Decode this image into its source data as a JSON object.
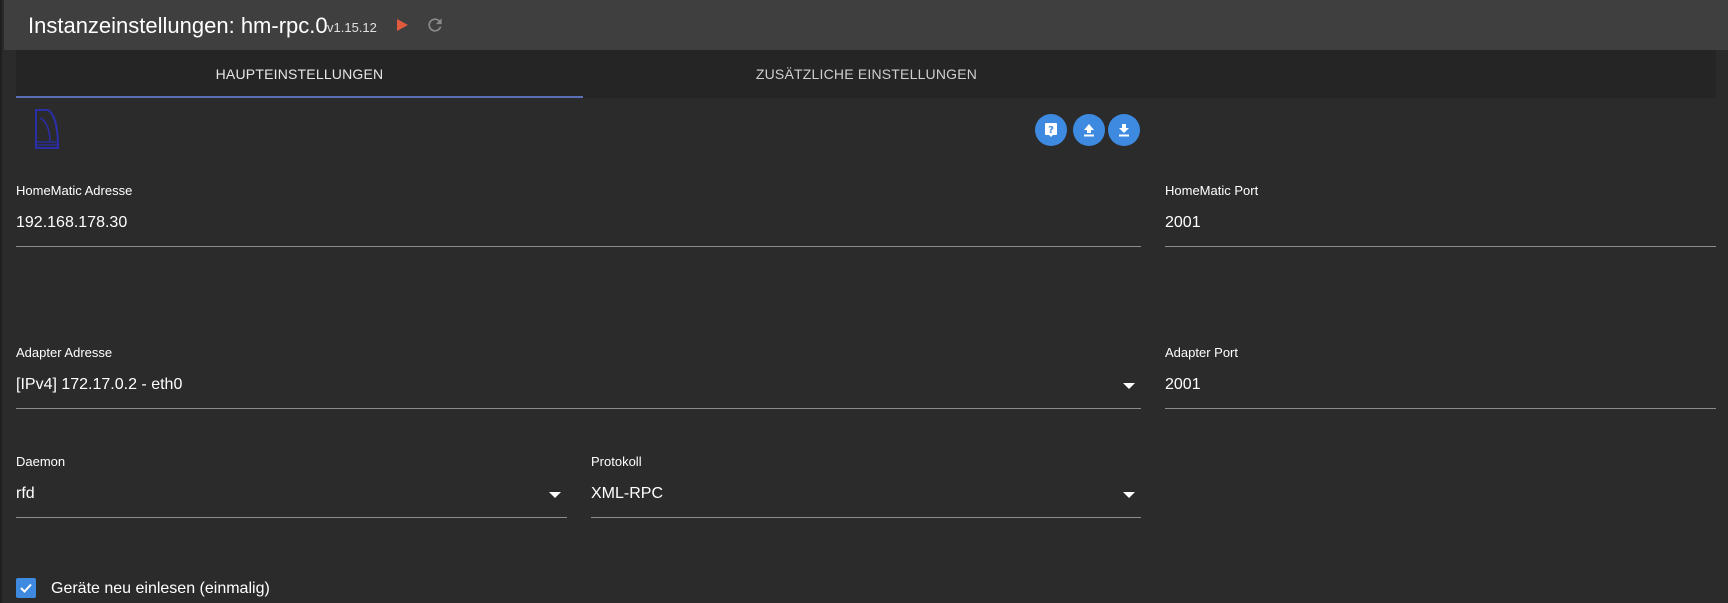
{
  "header": {
    "title": "Instanzeinstellungen: hm-rpc.0",
    "version": "v1.15.12",
    "colors": {
      "play": "#e05a3d",
      "reload": "#8a8a8a"
    }
  },
  "tabs": [
    {
      "label": "HAUPTEINSTELLUNGEN",
      "active": true
    },
    {
      "label": "ZUSÄTZLICHE EINSTELLUNGEN",
      "active": false
    }
  ],
  "actions": {
    "help_icon": "help-icon",
    "upload_icon": "upload-icon",
    "download_icon": "download-icon",
    "accent": "#3d8ae0"
  },
  "fields": {
    "homematic_address": {
      "label": "HomeMatic Adresse",
      "value": "192.168.178.30"
    },
    "homematic_port": {
      "label": "HomeMatic Port",
      "value": "2001"
    },
    "adapter_address": {
      "label": "Adapter Adresse",
      "value": "[IPv4] 172.17.0.2 - eth0"
    },
    "adapter_port": {
      "label": "Adapter Port",
      "value": "2001"
    },
    "daemon": {
      "label": "Daemon",
      "value": "rfd"
    },
    "protocol": {
      "label": "Protokoll",
      "value": "XML-RPC"
    }
  },
  "checkbox": {
    "label": "Geräte neu einlesen (einmalig)",
    "checked": true
  }
}
